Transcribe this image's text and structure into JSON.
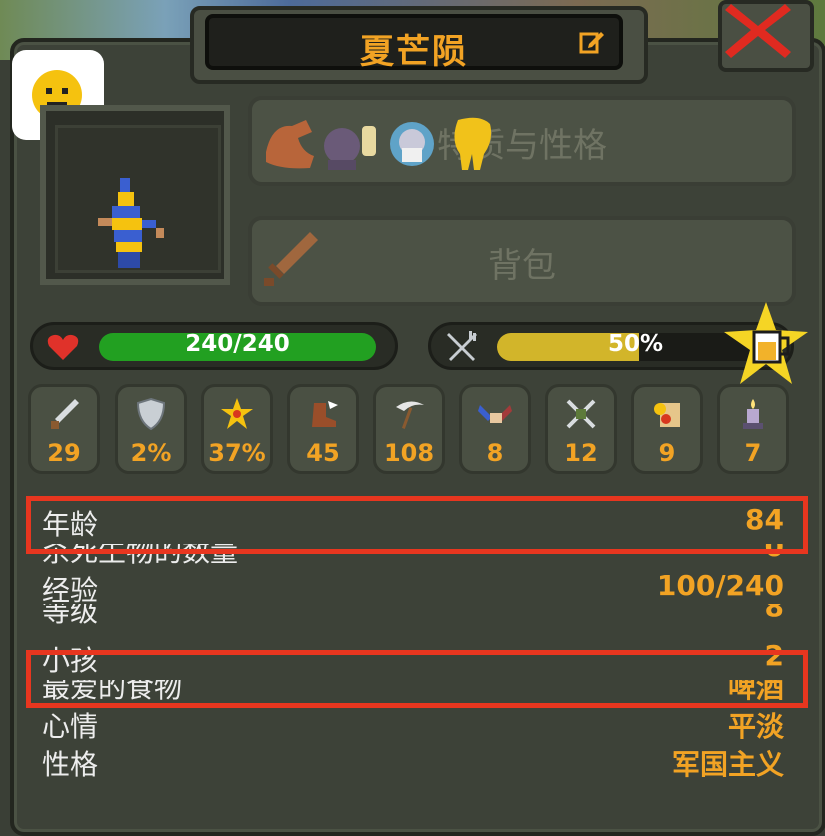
{
  "window": {
    "title": "夏芒陨",
    "edit_icon": "edit-icon",
    "close_icon": "close-icon"
  },
  "mood_icon": "neutral-face-icon",
  "slots": {
    "traits_label": "特质与性格",
    "inventory_label": "背包"
  },
  "bars": {
    "health": {
      "text": "240/240",
      "current": 240,
      "max": 240,
      "color": "#22a021"
    },
    "hunger": {
      "text": "50%",
      "fraction": 0.5,
      "color": "#d2b52a"
    }
  },
  "stats": [
    {
      "icon": "damage-sword-icon",
      "value": "29"
    },
    {
      "icon": "armor-shield-icon",
      "value": "2%"
    },
    {
      "icon": "critical-star-icon",
      "value": "37%"
    },
    {
      "icon": "attack-speed-boot-icon",
      "value": "45"
    },
    {
      "icon": "range-scythe-icon",
      "value": "108"
    },
    {
      "icon": "diplomacy-handshake-icon",
      "value": "8"
    },
    {
      "icon": "warfare-swords-icon",
      "value": "12"
    },
    {
      "icon": "stewardship-coins-icon",
      "value": "9"
    },
    {
      "icon": "intelligence-candle-icon",
      "value": "7"
    }
  ],
  "info": {
    "age": {
      "label": "年龄",
      "value": "84"
    },
    "kills": {
      "label": "杀死生物的数量",
      "value": "0"
    },
    "experience": {
      "label": "经验",
      "value": "100/240"
    },
    "level": {
      "label": "等级",
      "value": "8"
    },
    "children": {
      "label": "小孩",
      "value": "2"
    },
    "favorite_food": {
      "label": "最爱的食物",
      "value": "啤酒"
    },
    "mood": {
      "label": "心情",
      "value": "平淡"
    },
    "personality": {
      "label": "性格",
      "value": "军国主义"
    }
  },
  "colors": {
    "accent": "#f2a324",
    "highlight": "#e8361f",
    "panel": "#3d4238"
  }
}
